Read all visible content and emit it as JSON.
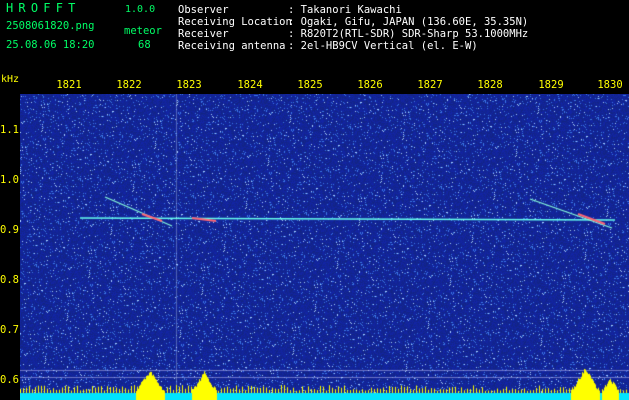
{
  "app": {
    "title": "HROFFT",
    "version": "1.0.0",
    "filename": "2508061820.png",
    "meteor_label": "meteor",
    "datetime": "25.08.06 18:20",
    "meteor_count": "68"
  },
  "info": {
    "observer_key": "Observer",
    "observer_val": ": Takanori Kawachi",
    "location_key": "Receiving Location",
    "location_val": ": Ogaki, Gifu, JAPAN (136.60E, 35.35N)",
    "receiver_key": "Receiver",
    "receiver_val": ": R820T2(RTL-SDR) SDR-Sharp 53.1000MHz",
    "antenna_key": "Receiving antenna",
    "antenna_val": ": 2el-HB9CV Vertical (el. E-W)"
  },
  "axes": {
    "y_unit": "kHz",
    "x_ticks": [
      "1821",
      "1822",
      "1823",
      "1824",
      "1825",
      "1826",
      "1827",
      "1828",
      "1829",
      "1830"
    ],
    "y_ticks": [
      "1.1",
      "1.0",
      "0.9",
      "0.8",
      "0.7",
      "0.6"
    ]
  },
  "colors": {
    "text_green": "#00ff66",
    "text_yellow": "#ffff00",
    "background_blue": "#1a2f8f",
    "trace_cyan": "#66ffee",
    "baseline_cyan": "#00e5ff",
    "burst_yellow": "#ffff00"
  }
}
